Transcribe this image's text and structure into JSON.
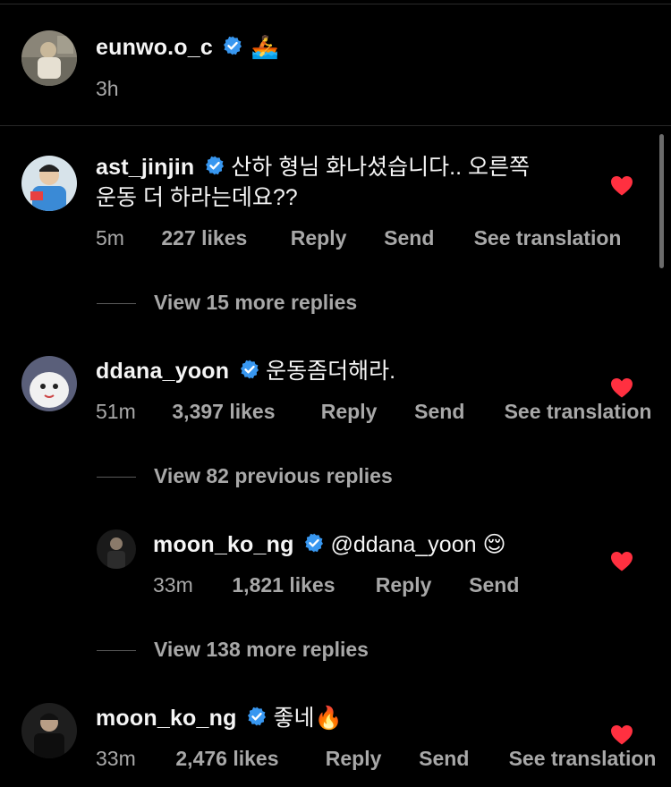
{
  "post": {
    "username": "eunwo.o_c",
    "emoji": "🚣",
    "time": "3h"
  },
  "comments": [
    {
      "username": "ast_jinjin",
      "text_line1": "산하 형님 화나셨습니다.. 오른쪽",
      "text_line2": "운동 더 하라는데요??",
      "time": "5m",
      "likes": "227 likes",
      "reply": "Reply",
      "send": "Send",
      "translate": "See translation"
    },
    {
      "username": "ddana_yoon",
      "text": "운동좀더해라.",
      "time": "51m",
      "likes": "3,397 likes",
      "reply": "Reply",
      "send": "Send",
      "translate": "See translation"
    },
    {
      "username": "moon_ko_ng",
      "text": "@ddana_yoon 😌",
      "time": "33m",
      "likes": "1,821 likes",
      "reply": "Reply",
      "send": "Send"
    },
    {
      "username": "moon_ko_ng",
      "text": "좋네🔥",
      "time": "33m",
      "likes": "2,476 likes",
      "reply": "Reply",
      "send": "Send",
      "translate": "See translation"
    }
  ],
  "view_more": {
    "first": "View 15 more replies",
    "previous": "View 82 previous replies",
    "second": "View 138 more replies"
  },
  "colors": {
    "background": "#000000",
    "text": "#f5f5f5",
    "secondary": "#a8a8a8",
    "verified": "#3897f0",
    "heart": "#ff3040"
  }
}
